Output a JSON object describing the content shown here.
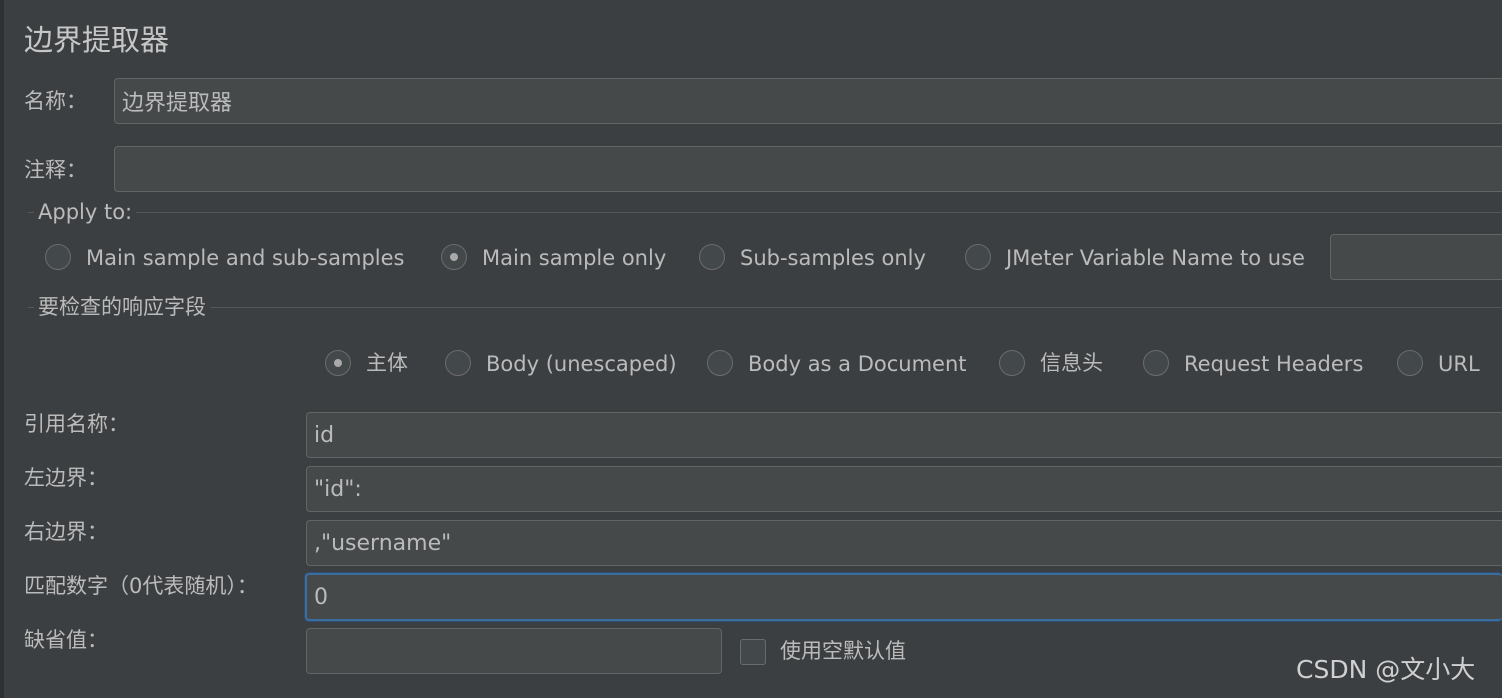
{
  "panel": {
    "title": "边界提取器"
  },
  "name_row": {
    "label": "名称：",
    "value": "边界提取器"
  },
  "comment_row": {
    "label": "注释：",
    "value": ""
  },
  "apply_to": {
    "title": "Apply to:",
    "options": [
      {
        "label": "Main sample and sub-samples",
        "selected": false
      },
      {
        "label": "Main sample only",
        "selected": true
      },
      {
        "label": "Sub-samples only",
        "selected": false
      },
      {
        "label": "JMeter Variable Name to use",
        "selected": false
      }
    ],
    "variable_value": ""
  },
  "response_field": {
    "title": "要检查的响应字段",
    "options": [
      {
        "label": "主体",
        "selected": true
      },
      {
        "label": "Body (unescaped)",
        "selected": false
      },
      {
        "label": "Body as a Document",
        "selected": false
      },
      {
        "label": "信息头",
        "selected": false
      },
      {
        "label": "Request Headers",
        "selected": false
      },
      {
        "label": "URL",
        "selected": false
      }
    ]
  },
  "ref_name": {
    "label": "引用名称：",
    "value": "id"
  },
  "left_boundary": {
    "label": "左边界：",
    "value": "\"id\":"
  },
  "right_boundary": {
    "label": "右边界：",
    "value": ",\"username\""
  },
  "match_no": {
    "label": "匹配数字（0代表随机）：",
    "value": "0"
  },
  "default_value": {
    "label": "缺省值：",
    "value": "",
    "use_empty_label": "使用空默认值",
    "use_empty_checked": false
  },
  "watermark": "CSDN @文小大"
}
